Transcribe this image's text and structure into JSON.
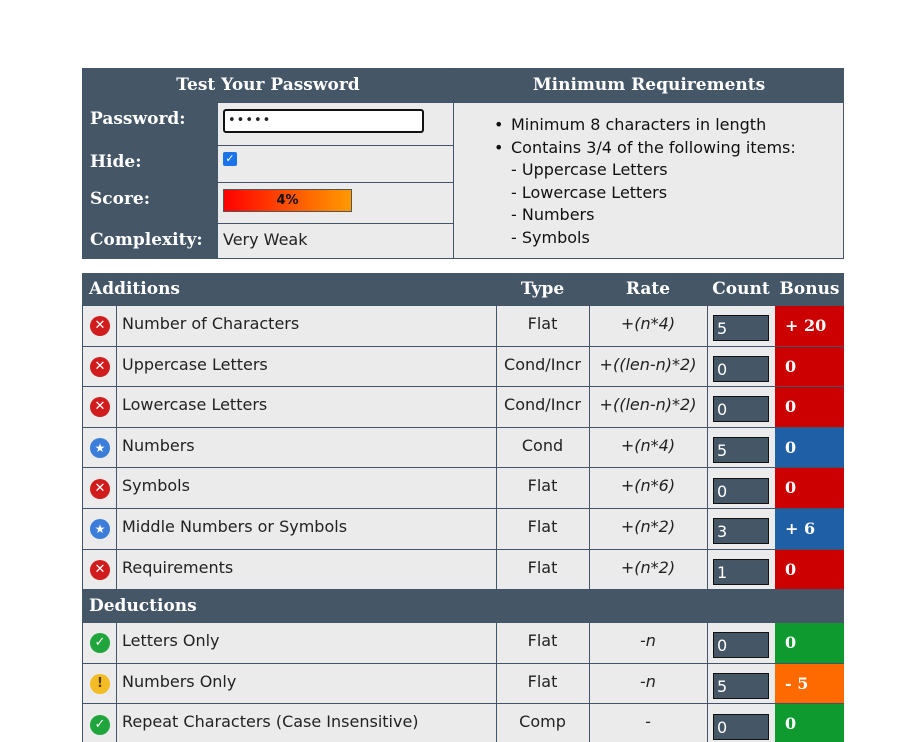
{
  "top": {
    "left_header": "Test Your Password",
    "right_header": "Minimum Requirements",
    "password_label": "Password:",
    "password_value": "•••••",
    "hide_label": "Hide:",
    "hide_checked": true,
    "score_label": "Score:",
    "score_text": "4%",
    "score_value": 0.04,
    "complexity_label": "Complexity:",
    "complexity_value": "Very Weak",
    "requirements": {
      "bullets": [
        "Minimum 8 characters in length",
        "Contains 3/4 of the following items:"
      ],
      "sub_items": [
        "- Uppercase Letters",
        "- Lowercase Letters",
        "- Numbers",
        "- Symbols"
      ]
    }
  },
  "table": {
    "headers": {
      "additions": "Additions",
      "type": "Type",
      "rate": "Rate",
      "count": "Count",
      "bonus": "Bonus"
    },
    "deductions_header": "Deductions",
    "additions": [
      {
        "icon": "failure-x-icon",
        "name": "Number of Characters",
        "type": "Flat",
        "rate": "+(n*4)",
        "count": "5",
        "bonus": "+ 20",
        "status": "fail"
      },
      {
        "icon": "failure-x-icon",
        "name": "Uppercase Letters",
        "type": "Cond/Incr",
        "rate": "+((len-n)*2)",
        "count": "0",
        "bonus": "0",
        "status": "fail"
      },
      {
        "icon": "failure-x-icon",
        "name": "Lowercase Letters",
        "type": "Cond/Incr",
        "rate": "+((len-n)*2)",
        "count": "0",
        "bonus": "0",
        "status": "fail"
      },
      {
        "icon": "sufficient-star-icon",
        "name": "Numbers",
        "type": "Cond",
        "rate": "+(n*4)",
        "count": "5",
        "bonus": "0",
        "status": "sufficient"
      },
      {
        "icon": "failure-x-icon",
        "name": "Symbols",
        "type": "Flat",
        "rate": "+(n*6)",
        "count": "0",
        "bonus": "0",
        "status": "fail"
      },
      {
        "icon": "sufficient-star-icon",
        "name": "Middle Numbers or Symbols",
        "type": "Flat",
        "rate": "+(n*2)",
        "count": "3",
        "bonus": "+ 6",
        "status": "sufficient"
      },
      {
        "icon": "failure-x-icon",
        "name": "Requirements",
        "type": "Flat",
        "rate": "+(n*2)",
        "count": "1",
        "bonus": "0",
        "status": "fail"
      }
    ],
    "deductions": [
      {
        "icon": "pass-check-icon",
        "name": "Letters Only",
        "type": "Flat",
        "rate": "-n",
        "count": "0",
        "bonus": "0",
        "status": "pass"
      },
      {
        "icon": "warning-icon",
        "name": "Numbers Only",
        "type": "Flat",
        "rate": "-n",
        "count": "5",
        "bonus": "- 5",
        "status": "warn"
      },
      {
        "icon": "pass-check-icon",
        "name": "Repeat Characters (Case Insensitive)",
        "type": "Comp",
        "rate": "-",
        "count": "0",
        "bonus": "0",
        "status": "pass"
      }
    ]
  },
  "colors": {
    "header_bg": "#455667",
    "fail": "#cc0000",
    "sufficient": "#1f5fa5",
    "pass": "#0e9a2e",
    "warn": "#ff6a00"
  }
}
